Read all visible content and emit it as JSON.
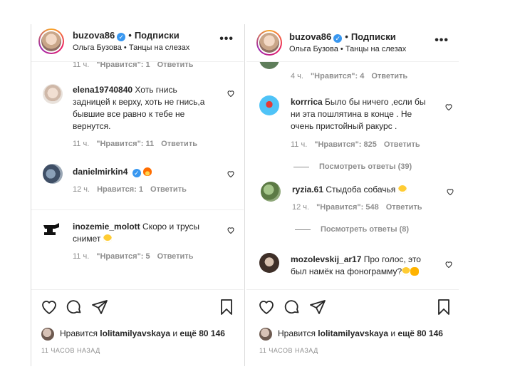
{
  "panels": [
    {
      "header": {
        "username": "buzova86",
        "follow": "Подписки",
        "subline": "Ольга Бузова • Танцы на слезах"
      },
      "comments": [
        {
          "meta": {
            "time": "11 ч.",
            "likes": "\"Нравится\": 1",
            "reply": "Ответить"
          }
        },
        {
          "username": "elena19740840",
          "text": "Хоть гнись задницей к верху, хоть не гнись,а бывшие все равно к тебе не вернутся.",
          "meta": {
            "time": "11 ч.",
            "likes": "\"Нравится\": 11",
            "reply": "Ответить"
          }
        },
        {
          "username": "danielmirkin4",
          "text": "",
          "meta": {
            "time": "12 ч.",
            "likes": "Нравится: 1",
            "reply": "Ответить"
          }
        },
        {
          "username": "inozemie_molott",
          "text": "Скоро и трусы снимет",
          "meta": {
            "time": "11 ч.",
            "likes": "\"Нравится\": 5",
            "reply": "Ответить"
          }
        }
      ],
      "likes": {
        "prefix": "Нравится",
        "user": "lolitamilyavskaya",
        "mid": "и",
        "rest": "ещё 80 146"
      },
      "time_ago": "11 ЧАСОВ НАЗАД"
    },
    {
      "header": {
        "username": "buzova86",
        "follow": "Подписки",
        "subline": "Ольга Бузова • Танцы на слезах"
      },
      "comments": [
        {
          "meta": {
            "time": "4 ч.",
            "likes": "\"Нравится\": 4",
            "reply": "Ответить"
          }
        },
        {
          "username": "korrrica",
          "text": "Было бы ничего ,если бы ни эта пошлятина в конце . Не очень пристойный ракурс .",
          "meta": {
            "time": "11 ч.",
            "likes": "\"Нравится\": 825",
            "reply": "Ответить"
          }
        },
        {
          "replies": "Посмотреть ответы (39)"
        },
        {
          "username": "ryzia.61",
          "text": "Стыдоба собачья",
          "meta": {
            "time": "12 ч.",
            "likes": "\"Нравится\": 548",
            "reply": "Ответить"
          }
        },
        {
          "replies": "Посмотреть ответы (8)"
        },
        {
          "username": "mozolevskij_ar17",
          "text": "Про голос, это был намёк на фонограмму?"
        }
      ],
      "likes": {
        "prefix": "Нравится",
        "user": "lolitamilyavskaya",
        "mid": "и",
        "rest": "ещё 80 146"
      },
      "time_ago": "11 ЧАСОВ НАЗАД"
    }
  ],
  "icons": {
    "more": "more-options-icon",
    "verified": "verified-badge-icon",
    "like": "heart-icon",
    "comment": "comment-icon",
    "share": "send-icon",
    "save": "bookmark-icon"
  },
  "colors": {
    "verified": "#3897f0",
    "meta": "#8e8e8e",
    "text": "#262626",
    "border": "#dbdbdb"
  }
}
